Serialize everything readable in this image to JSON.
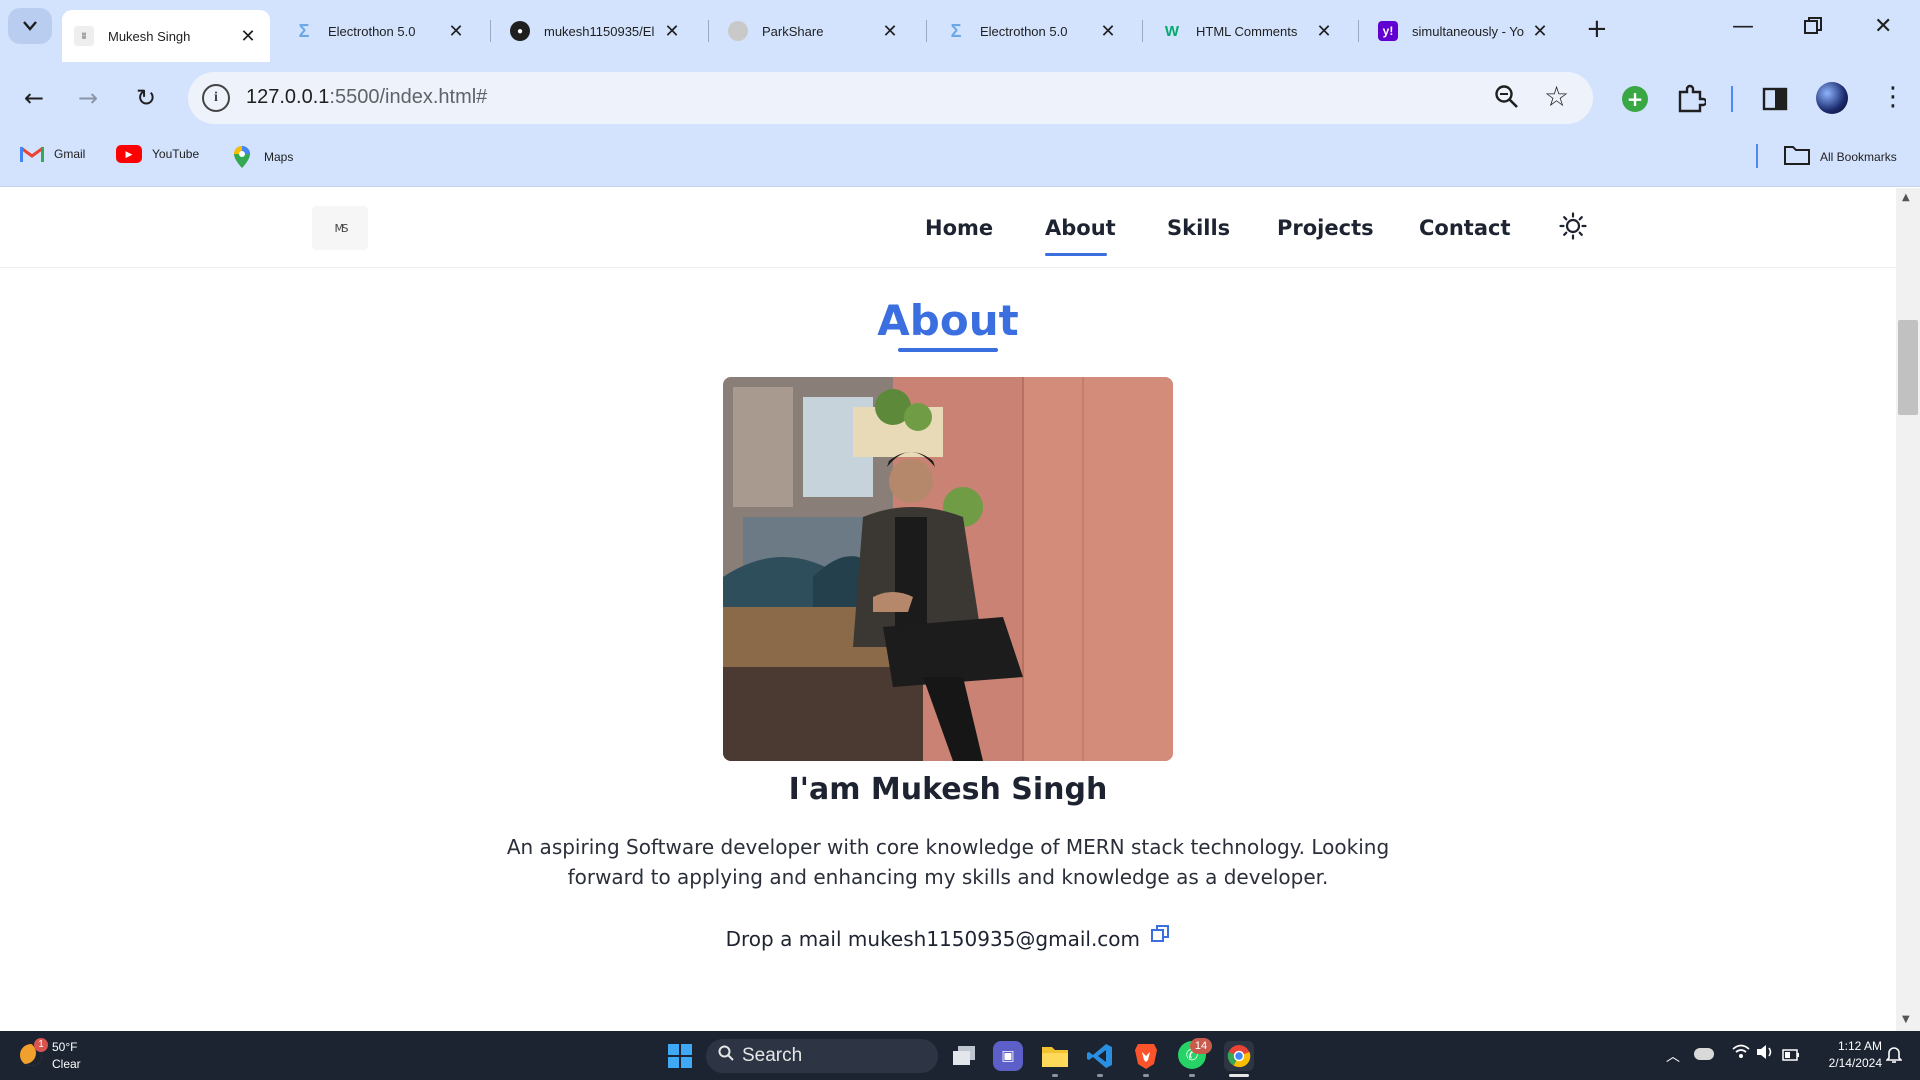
{
  "browser": {
    "tabs": [
      {
        "title": "Mukesh Singh",
        "favicon": "ms-logo-icon",
        "active": true
      },
      {
        "title": "Electrothon 5.0",
        "favicon": "electrothon-icon",
        "active": false
      },
      {
        "title": "mukesh1150935/El",
        "favicon": "github-icon",
        "active": false
      },
      {
        "title": "ParkShare",
        "favicon": "globe-icon",
        "active": false
      },
      {
        "title": "Electrothon 5.0",
        "favicon": "electrothon-icon",
        "active": false
      },
      {
        "title": "HTML Comments",
        "favicon": "w3schools-icon",
        "active": false
      },
      {
        "title": "simultaneously - Yo",
        "favicon": "yahoo-icon",
        "active": false
      }
    ],
    "address": {
      "host": "127.0.0.1",
      "path": ":5500/index.html#"
    },
    "bookmarks": [
      {
        "label": "Gmail",
        "icon": "gmail-icon"
      },
      {
        "label": "YouTube",
        "icon": "youtube-icon"
      },
      {
        "label": "Maps",
        "icon": "maps-icon"
      }
    ],
    "all_bookmarks": "All Bookmarks"
  },
  "site": {
    "logo": "M S",
    "nav": [
      "Home",
      "About",
      "Skills",
      "Projects",
      "Contact"
    ],
    "active_nav": "About",
    "theme_toggle_icon": "sun-icon",
    "section_title": "About",
    "name": "I'am Mukesh Singh",
    "bio": "An aspiring Software developer with core knowledge of MERN stack technology. Looking forward to applying and enhancing my skills and knowledge as a developer.",
    "mail_prefix": "Drop a mail",
    "email": "mukesh1150935@gmail.com",
    "accent": "#3b6fe0"
  },
  "taskbar": {
    "weather_temp": "50°F",
    "weather_desc": "Clear",
    "weather_badge": "1",
    "search": "Search",
    "whatsapp_badge": "14",
    "time": "1:12 AM",
    "date": "2/14/2024"
  }
}
